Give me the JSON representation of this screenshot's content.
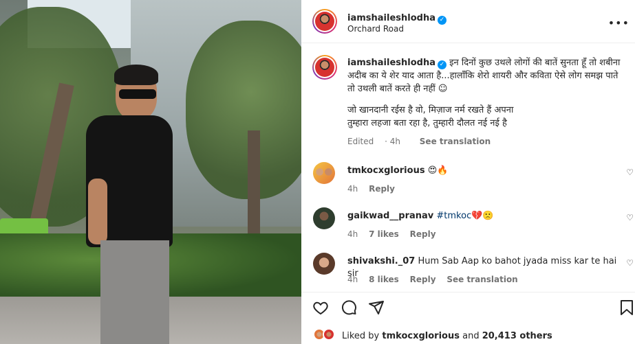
{
  "post": {
    "username": "iamshaileshlodha",
    "location": "Orchard Road",
    "caption_line1": "इन दिनों कुछ उथले लोगों की बातें सुनता हूँ तो शबीना अदीब का ये शेर याद आता है...हालाँकि शेरो शायरी और कविता ऐसे लोग समझ पाते तो उथली बातें करते ही नहीं ☺",
    "caption_line2": "जो खानदानी रईस है वो, मिज़ाज नर्म रखते हैं अपना",
    "caption_line3": "तुम्हारा लहजा बता रहा है, तुम्हारी दौलत नई नई है",
    "caption_status": "Edited",
    "caption_time": "4h",
    "caption_translate": "See translation"
  },
  "comments": [
    {
      "username": "tmkocxglorious",
      "text": "😍🔥",
      "time": "4h",
      "likes": "",
      "reply": "Reply",
      "translate": ""
    },
    {
      "username": "gaikwad__pranav",
      "hashtag": "#tmkoc",
      "text": "💔🙁",
      "time": "4h",
      "likes": "7 likes",
      "reply": "Reply",
      "translate": ""
    },
    {
      "username": "shivakshi._07",
      "text": "Hum Sab Aap ko bahot jyada miss kar te hai sir",
      "time": "4h",
      "likes": "8 likes",
      "reply": "Reply",
      "translate": "See translation"
    }
  ],
  "likes": {
    "prefix": "Liked by",
    "user": "tmkocxglorious",
    "middle": "and",
    "count": "20,413 others"
  },
  "icons": [
    "heart-icon",
    "comment-icon",
    "share-icon",
    "bookmark-icon",
    "more-icon",
    "verified-icon"
  ],
  "colors": {
    "verified": "#0095f6",
    "link": "#00376b",
    "muted": "#737373"
  }
}
